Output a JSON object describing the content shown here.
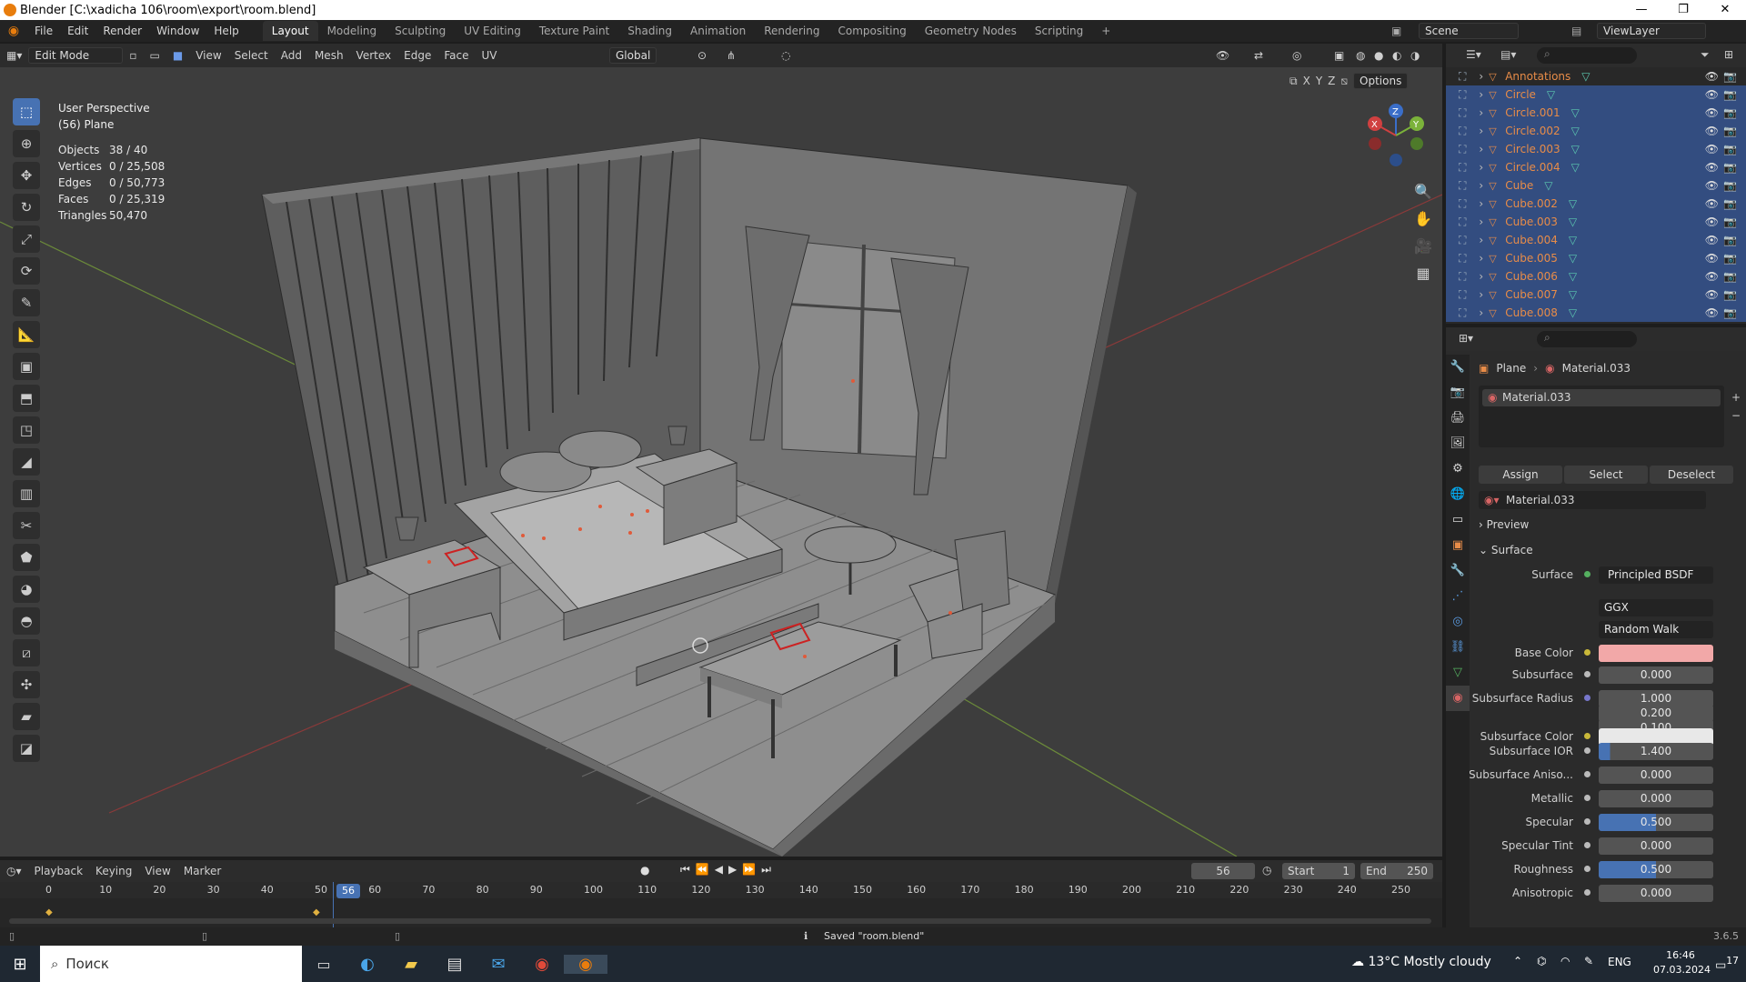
{
  "window": {
    "title": "Blender [C:\\xadicha 106\\room\\export\\room.blend]",
    "min": "—",
    "max": "❐",
    "close": "✕"
  },
  "menu": [
    "File",
    "Edit",
    "Render",
    "Window",
    "Help"
  ],
  "workspaces": [
    "Layout",
    "Modeling",
    "Sculpting",
    "UV Editing",
    "Texture Paint",
    "Shading",
    "Animation",
    "Rendering",
    "Compositing",
    "Geometry Nodes",
    "Scripting",
    "+"
  ],
  "scene": {
    "label": "Scene",
    "viewlayer": "ViewLayer"
  },
  "viewport_header": {
    "mode": "Edit Mode",
    "menus": [
      "View",
      "Select",
      "Add",
      "Mesh",
      "Vertex",
      "Edge",
      "Face",
      "UV"
    ],
    "transform": "Global",
    "options": "Options",
    "axes": [
      "X",
      "Y",
      "Z"
    ]
  },
  "overlay": {
    "perspective": "User Perspective",
    "object": "(56) Plane"
  },
  "stats": [
    {
      "k": "Objects",
      "v": "38 / 40"
    },
    {
      "k": "Vertices",
      "v": "0 / 25,508"
    },
    {
      "k": "Edges",
      "v": "0 / 50,773"
    },
    {
      "k": "Faces",
      "v": "0 / 25,319"
    },
    {
      "k": "Triangles",
      "v": "50,470"
    }
  ],
  "gizmo": {
    "x": "X",
    "y": "Y",
    "z": "Z"
  },
  "outliner": [
    {
      "name": "Annotations",
      "sel": false
    },
    {
      "name": "Circle",
      "sel": true
    },
    {
      "name": "Circle.001",
      "sel": true
    },
    {
      "name": "Circle.002",
      "sel": true
    },
    {
      "name": "Circle.003",
      "sel": true
    },
    {
      "name": "Circle.004",
      "sel": true
    },
    {
      "name": "Cube",
      "sel": true
    },
    {
      "name": "Cube.002",
      "sel": true
    },
    {
      "name": "Cube.003",
      "sel": true
    },
    {
      "name": "Cube.004",
      "sel": true
    },
    {
      "name": "Cube.005",
      "sel": true
    },
    {
      "name": "Cube.006",
      "sel": true
    },
    {
      "name": "Cube.007",
      "sel": true
    },
    {
      "name": "Cube.008",
      "sel": true
    }
  ],
  "properties": {
    "breadcrumb_object": "Plane",
    "breadcrumb_material": "Material.033",
    "slot": "Material.033",
    "assign": "Assign",
    "select": "Select",
    "deselect": "Deselect",
    "material_name": "Material.033",
    "preview": "Preview",
    "surface_panel": "Surface",
    "surface_label": "Surface",
    "surface_value": "Principled BSDF",
    "distribution": "GGX",
    "sss_method": "Random Walk",
    "base_color_label": "Base Color",
    "base_color": "#f2a8a8",
    "subsurface_color_color": "#e8e8e8",
    "rows": [
      {
        "label": "Subsurface",
        "value": "0.000",
        "fill": 0
      },
      {
        "label": "Subsurface Radius",
        "value": "1.000",
        "fill": 0
      },
      {
        "label": "",
        "value": "0.200",
        "fill": 0
      },
      {
        "label": "",
        "value": "0.100",
        "fill": 0
      },
      {
        "label": "Subsurface IOR",
        "value": "1.400",
        "fill": 0.1
      },
      {
        "label": "Subsurface Aniso...",
        "value": "0.000",
        "fill": 0
      },
      {
        "label": "Metallic",
        "value": "0.000",
        "fill": 0
      },
      {
        "label": "Specular",
        "value": "0.500",
        "fill": 0.5
      },
      {
        "label": "Specular Tint",
        "value": "0.000",
        "fill": 0
      },
      {
        "label": "Roughness",
        "value": "0.500",
        "fill": 0.5
      },
      {
        "label": "Anisotropic",
        "value": "0.000",
        "fill": 0
      }
    ],
    "subsurface_color_label": "Subsurface Color"
  },
  "timeline": {
    "menus": [
      "Playback",
      "Keying",
      "View",
      "Marker"
    ],
    "current": "56",
    "start_label": "Start",
    "start": "1",
    "end_label": "End",
    "end": "250",
    "ticks": [
      "0",
      "10",
      "20",
      "30",
      "40",
      "50",
      "60",
      "70",
      "80",
      "90",
      "100",
      "110",
      "120",
      "130",
      "140",
      "150",
      "160",
      "170",
      "180",
      "190",
      "200",
      "210",
      "220",
      "230",
      "240",
      "250"
    ]
  },
  "status": {
    "message": "Saved \"room.blend\"",
    "version": "3.6.5"
  },
  "taskbar": {
    "search": "Поиск",
    "weather": "13°C  Mostly cloudy",
    "lang": "ENG",
    "time": "16:46",
    "date": "07.03.2024",
    "notif": "17"
  }
}
